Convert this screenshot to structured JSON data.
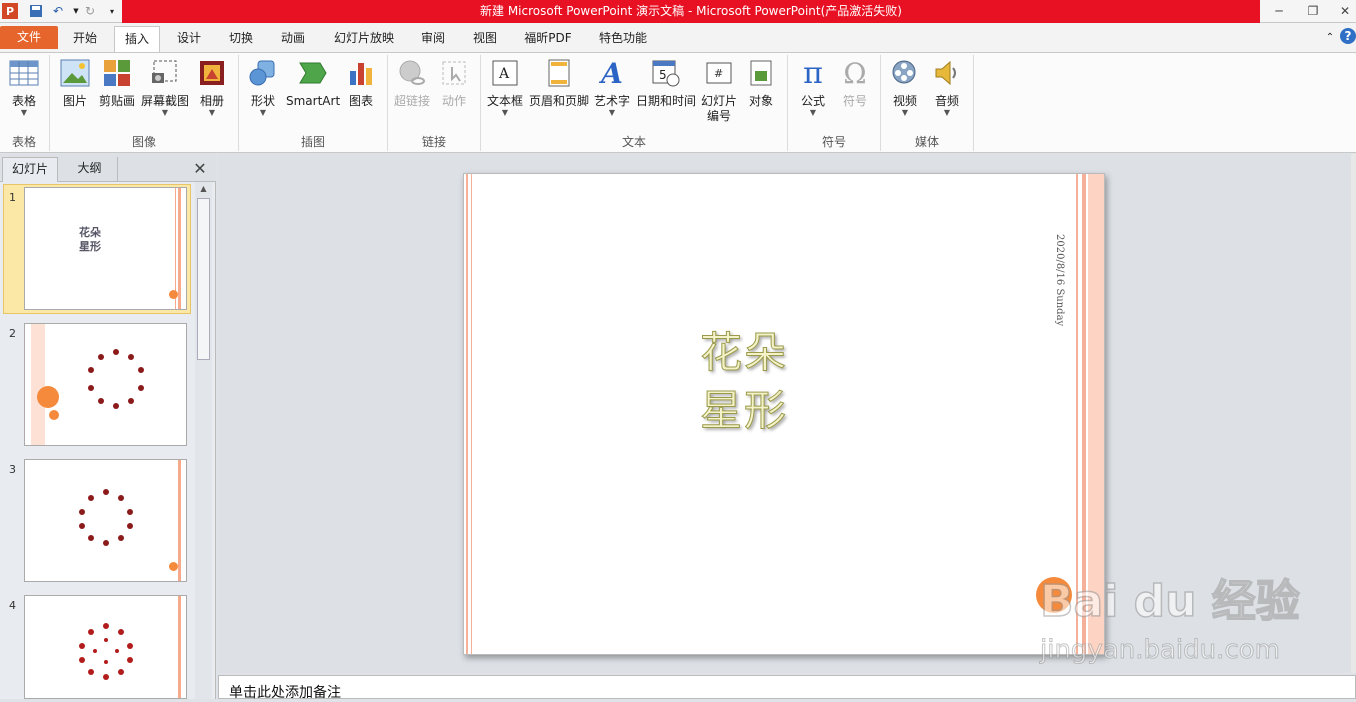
{
  "app": {
    "title": "新建 Microsoft PowerPoint 演示文稿 - Microsoft PowerPoint(产品激活失败)"
  },
  "tabs": [
    "文件",
    "开始",
    "插入",
    "设计",
    "切换",
    "动画",
    "幻灯片放映",
    "审阅",
    "视图",
    "福昕PDF",
    "特色功能"
  ],
  "ribbon": {
    "table": {
      "label": "表格",
      "group": "表格"
    },
    "images": {
      "picture": "图片",
      "clipart": "剪贴画",
      "screenshot": "屏幕截图",
      "album": "相册",
      "group": "图像"
    },
    "illus": {
      "shapes": "形状",
      "smartart": "SmartArt",
      "chart": "图表",
      "group": "插图"
    },
    "links": {
      "hyperlink": "超链接",
      "action": "动作",
      "group": "链接"
    },
    "text": {
      "textbox": "文本框",
      "headerfooter": "页眉和页脚",
      "wordart": "艺术字",
      "datetime": "日期和时间",
      "slidenum1": "幻灯片",
      "slidenum2": "编号",
      "object": "对象",
      "group": "文本"
    },
    "symbols": {
      "equation": "公式",
      "symbol": "符号",
      "group": "符号"
    },
    "media": {
      "video": "视频",
      "audio": "音频",
      "group": "媒体"
    }
  },
  "leftpane": {
    "tab_slides": "幻灯片",
    "tab_outline": "大纲",
    "thumb1_title": "花朵\n星形",
    "numbers": [
      "1",
      "2",
      "3",
      "4"
    ]
  },
  "slide": {
    "title_line1": "花朵",
    "title_line2": "星形",
    "date": "2020/8/16 Sunday"
  },
  "notes": {
    "placeholder": "单击此处添加备注"
  },
  "watermark": {
    "brand": "Bai du 经验",
    "url": "jingyan.baidu.com"
  },
  "colors": {
    "file_tab": "#e5652d",
    "title_red": "#e81123",
    "accent_orange": "#f58a3c"
  }
}
